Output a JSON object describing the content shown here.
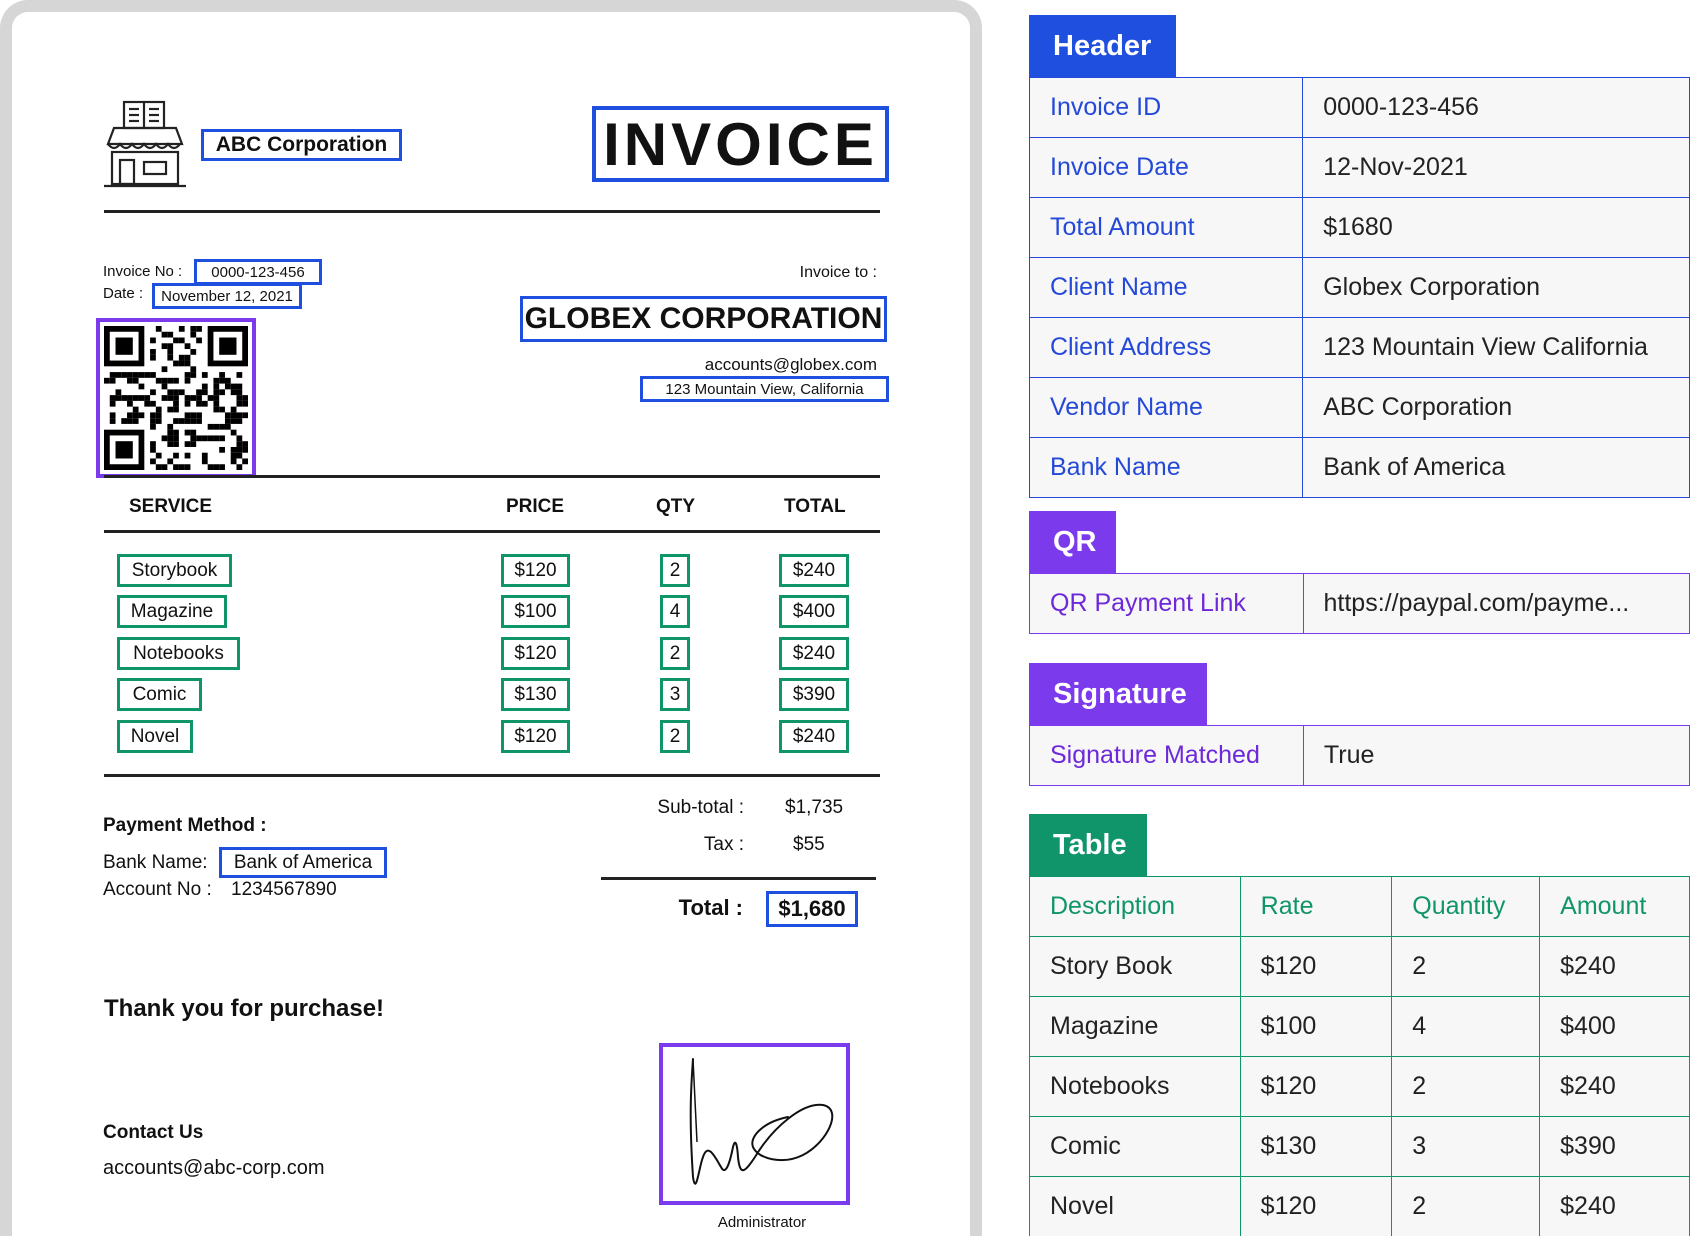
{
  "invoice": {
    "vendor_name": "ABC Corporation",
    "title": "INVOICE",
    "invoice_no_label": "Invoice No :",
    "invoice_no": "0000-123-456",
    "date_label": "Date :",
    "date": "November 12, 2021",
    "invoice_to_label": "Invoice to :",
    "client_name": "GLOBEX CORPORATION",
    "client_email": "accounts@globex.com",
    "client_address": "123 Mountain View, California",
    "columns": [
      "SERVICE",
      "PRICE",
      "QTY",
      "TOTAL"
    ],
    "items": [
      {
        "service": "Storybook",
        "price": "$120",
        "qty": "2",
        "total": "$240"
      },
      {
        "service": "Magazine",
        "price": "$100",
        "qty": "4",
        "total": "$400"
      },
      {
        "service": "Notebooks",
        "price": "$120",
        "qty": "2",
        "total": "$240"
      },
      {
        "service": "Comic",
        "price": "$130",
        "qty": "3",
        "total": "$390"
      },
      {
        "service": "Novel",
        "price": "$120",
        "qty": "2",
        "total": "$240"
      }
    ],
    "subtotal_label": "Sub-total :",
    "subtotal": "$1,735",
    "tax_label": "Tax :",
    "tax": "$55",
    "total_label": "Total :",
    "total": "$1,680",
    "payment_method_label": "Payment Method :",
    "bank_name_label": "Bank Name:",
    "bank_name": "Bank of America",
    "account_no_label": "Account No :",
    "account_no": "1234567890",
    "thanks": "Thank you for purchase!",
    "contact_label": "Contact Us",
    "contact_email": "accounts@abc-corp.com",
    "signature_caption": "Administrator"
  },
  "panel": {
    "header": {
      "title": "Header",
      "rows": [
        {
          "key": "Invoice ID",
          "value": "0000-123-456"
        },
        {
          "key": "Invoice Date",
          "value": "12-Nov-2021"
        },
        {
          "key": "Total Amount",
          "value": "$1680"
        },
        {
          "key": "Client Name",
          "value": "Globex Corporation"
        },
        {
          "key": "Client Address",
          "value": "123 Mountain View California"
        },
        {
          "key": "Vendor Name",
          "value": "ABC Corporation"
        },
        {
          "key": "Bank Name",
          "value": "Bank of America"
        }
      ]
    },
    "qr": {
      "title": "QR",
      "rows": [
        {
          "key": "QR Payment Link",
          "value": "https://paypal.com/payme..."
        }
      ]
    },
    "signature": {
      "title": "Signature",
      "rows": [
        {
          "key": "Signature Matched",
          "value": "True"
        }
      ]
    },
    "table": {
      "title": "Table",
      "columns": [
        "Description",
        "Rate",
        "Quantity",
        "Amount"
      ],
      "rows": [
        [
          "Story Book",
          "$120",
          "2",
          "$240"
        ],
        [
          "Magazine",
          "$100",
          "4",
          "$400"
        ],
        [
          "Notebooks",
          "$120",
          "2",
          "$240"
        ],
        [
          "Comic",
          "$130",
          "3",
          "$390"
        ],
        [
          "Novel",
          "$120",
          "2",
          "$240"
        ]
      ]
    }
  },
  "colors": {
    "header_accent": "#1f4fdf",
    "qr_accent": "#7c3aed",
    "signature_accent": "#7c3aed",
    "table_accent": "#10946a"
  },
  "icons": [
    "store-icon",
    "qr-code",
    "signature"
  ]
}
